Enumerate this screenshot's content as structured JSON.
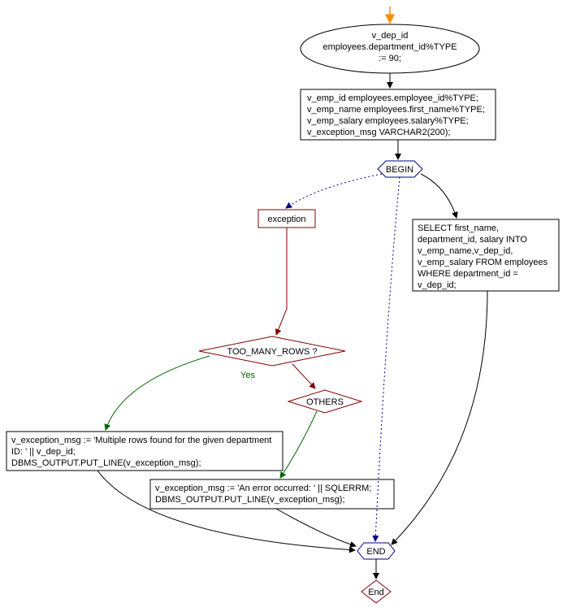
{
  "chart_data": {
    "type": "flowchart",
    "nodes": [
      {
        "id": "start",
        "shape": "arrow-entry",
        "text": ""
      },
      {
        "id": "declare1",
        "shape": "ellipse",
        "text": "v_dep_id\nemployees.department_id%TYPE\n:= 90;"
      },
      {
        "id": "declare2",
        "shape": "rect",
        "text": "v_emp_id employees.employee_id%TYPE;\nv_emp_name employees.first_name%TYPE;\nv_emp_salary employees.salary%TYPE;\nv_exception_msg VARCHAR2(200);"
      },
      {
        "id": "begin",
        "shape": "hexagon",
        "text": "BEGIN",
        "color": "navy"
      },
      {
        "id": "exception",
        "shape": "rect",
        "text": "exception",
        "color": "maroon"
      },
      {
        "id": "select",
        "shape": "rect",
        "text": "SELECT first_name,\ndepartment_id, salary INTO\nv_emp_name,v_dep_id,\nv_emp_salary FROM employees\nWHERE department_id =\nv_dep_id;"
      },
      {
        "id": "too_many_rows",
        "shape": "diamond",
        "text": "TOO_MANY_ROWS ?",
        "color": "maroon"
      },
      {
        "id": "others",
        "shape": "diamond",
        "text": "OTHERS",
        "color": "maroon"
      },
      {
        "id": "msg1",
        "shape": "rect",
        "text": "v_exception_msg := 'Multiple rows found for the given department\nID: ' || v_dep_id;\nDBMS_OUTPUT.PUT_LINE(v_exception_msg);"
      },
      {
        "id": "msg2",
        "shape": "rect",
        "text": "v_exception_msg := 'An error occurred: ' || SQLERRM;\nDBMS_OUTPUT.PUT_LINE(v_exception_msg);"
      },
      {
        "id": "end",
        "shape": "hexagon",
        "text": "END",
        "color": "navy"
      },
      {
        "id": "terminal",
        "shape": "diamond",
        "text": "End",
        "color": "maroon"
      }
    ],
    "edges": [
      {
        "from": "start",
        "to": "declare1",
        "color": "orange"
      },
      {
        "from": "declare1",
        "to": "declare2",
        "color": "black"
      },
      {
        "from": "declare2",
        "to": "begin",
        "color": "black"
      },
      {
        "from": "begin",
        "to": "exception",
        "color": "navy",
        "style": "dotted"
      },
      {
        "from": "begin",
        "to": "select",
        "color": "black"
      },
      {
        "from": "begin",
        "to": "end",
        "color": "navy",
        "style": "dotted"
      },
      {
        "from": "exception",
        "to": "too_many_rows",
        "color": "maroon"
      },
      {
        "from": "too_many_rows",
        "to": "msg1",
        "label": "Yes",
        "color": "green"
      },
      {
        "from": "too_many_rows",
        "to": "others",
        "color": "maroon"
      },
      {
        "from": "others",
        "to": "msg2",
        "color": "green"
      },
      {
        "from": "msg1",
        "to": "end",
        "color": "black"
      },
      {
        "from": "msg2",
        "to": "end",
        "color": "black"
      },
      {
        "from": "select",
        "to": "end",
        "color": "black"
      },
      {
        "from": "end",
        "to": "terminal",
        "color": "black"
      }
    ]
  },
  "labels": {
    "declare1_l1": "v_dep_id",
    "declare1_l2": "employees.department_id%TYPE",
    "declare1_l3": ":= 90;",
    "declare2_l1": "v_emp_id employees.employee_id%TYPE;",
    "declare2_l2": "v_emp_name employees.first_name%TYPE;",
    "declare2_l3": "v_emp_salary employees.salary%TYPE;",
    "declare2_l4": "v_exception_msg VARCHAR2(200);",
    "begin": "BEGIN",
    "exception": "exception",
    "select_l1": "SELECT first_name,",
    "select_l2": "department_id, salary INTO",
    "select_l3": "v_emp_name,v_dep_id,",
    "select_l4": "v_emp_salary FROM employees",
    "select_l5": "WHERE department_id =",
    "select_l6": "v_dep_id;",
    "too_many_rows": "TOO_MANY_ROWS ?",
    "others": "OTHERS",
    "yes": "Yes",
    "msg1_l1": "v_exception_msg := 'Multiple rows found for the given department",
    "msg1_l2": "ID: ' || v_dep_id;",
    "msg1_l3": "DBMS_OUTPUT.PUT_LINE(v_exception_msg);",
    "msg2_l1": "v_exception_msg := 'An error occurred: ' || SQLERRM;",
    "msg2_l2": "DBMS_OUTPUT.PUT_LINE(v_exception_msg);",
    "end": "END",
    "terminal": "End"
  }
}
